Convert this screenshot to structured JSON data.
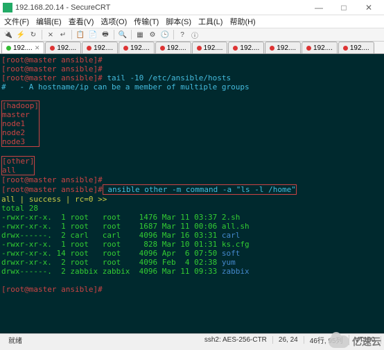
{
  "window": {
    "title": "192.168.20.14 - SecureCRT",
    "min": "—",
    "max": "□",
    "close": "✕"
  },
  "menu": {
    "file": "文件(F)",
    "edit": "编辑(E)",
    "view": "查看(V)",
    "options": "选项(O)",
    "transfer": "传输(T)",
    "script": "脚本(S)",
    "tools": "工具(L)",
    "help": "帮助(H)"
  },
  "tabs": {
    "items": [
      {
        "label": "192....",
        "active": true,
        "state": "green",
        "closable": true
      },
      {
        "label": "192....",
        "active": false,
        "state": "red"
      },
      {
        "label": "192....",
        "active": false,
        "state": "red"
      },
      {
        "label": "192....",
        "active": false,
        "state": "red"
      },
      {
        "label": "192....",
        "active": false,
        "state": "red"
      },
      {
        "label": "192....",
        "active": false,
        "state": "red"
      },
      {
        "label": "192....",
        "active": false,
        "state": "red"
      },
      {
        "label": "192....",
        "active": false,
        "state": "red"
      },
      {
        "label": "192....",
        "active": false,
        "state": "red"
      },
      {
        "label": "192....",
        "active": false,
        "state": "red"
      }
    ]
  },
  "term": {
    "p1": "[root@master ansible]#",
    "p2": "[root@master ansible]#",
    "p3": "[root@master ansible]#",
    "cmd_tail": " tail -10 /etc/ansible/hosts",
    "comment": "#   - A hostname/ip can be a member of multiple groups",
    "grp_hadoop": "[hadoop]",
    "h_master": "master",
    "h_node1": "node1",
    "h_node2": "node2",
    "h_node3": "node3",
    "grp_other": "[other]",
    "h_all": "all",
    "p4": "[root@master ansible]#",
    "p5": "[root@master ansible]#",
    "cmd_ansible": " ansible other -m command -a \"ls -l /home\"",
    "res_header": "all | success | rc=0 >>",
    "res_total": "total 28",
    "ls1": "-rwxr-xr-x.  1 root   root    1476 Mar 11 03:37 2.sh",
    "ls2": "-rwxr-xr-x.  1 root   root    1687 Mar 11 00:06 all.sh",
    "ls3_a": "drwx------.  2 carl   carl    4096 Mar 16 03:31 ",
    "ls3_b": "carl",
    "ls4": "-rwxr-xr-x.  1 root   root     828 Mar 10 01:31 ks.cfg",
    "ls5_a": "-rwxr-xr-x. 14 root   root    4096 Apr  6 07:50 ",
    "ls5_b": "soft",
    "ls6_a": "drwxr-xr-x.  2 root   root    4096 Feb  4 02:38 ",
    "ls6_b": "yum",
    "ls7_a": "drwx------.  2 zabbix zabbix  4096 Mar 11 09:33 ",
    "ls7_b": "zabbix",
    "p6": "[root@master ansible]#"
  },
  "status": {
    "ready": "就绪",
    "ssh": "ssh2: AES-256-CTR",
    "pos": "26, 24",
    "rc": "46行, 95列",
    "term": "VT100"
  },
  "watermark": "亿速云"
}
